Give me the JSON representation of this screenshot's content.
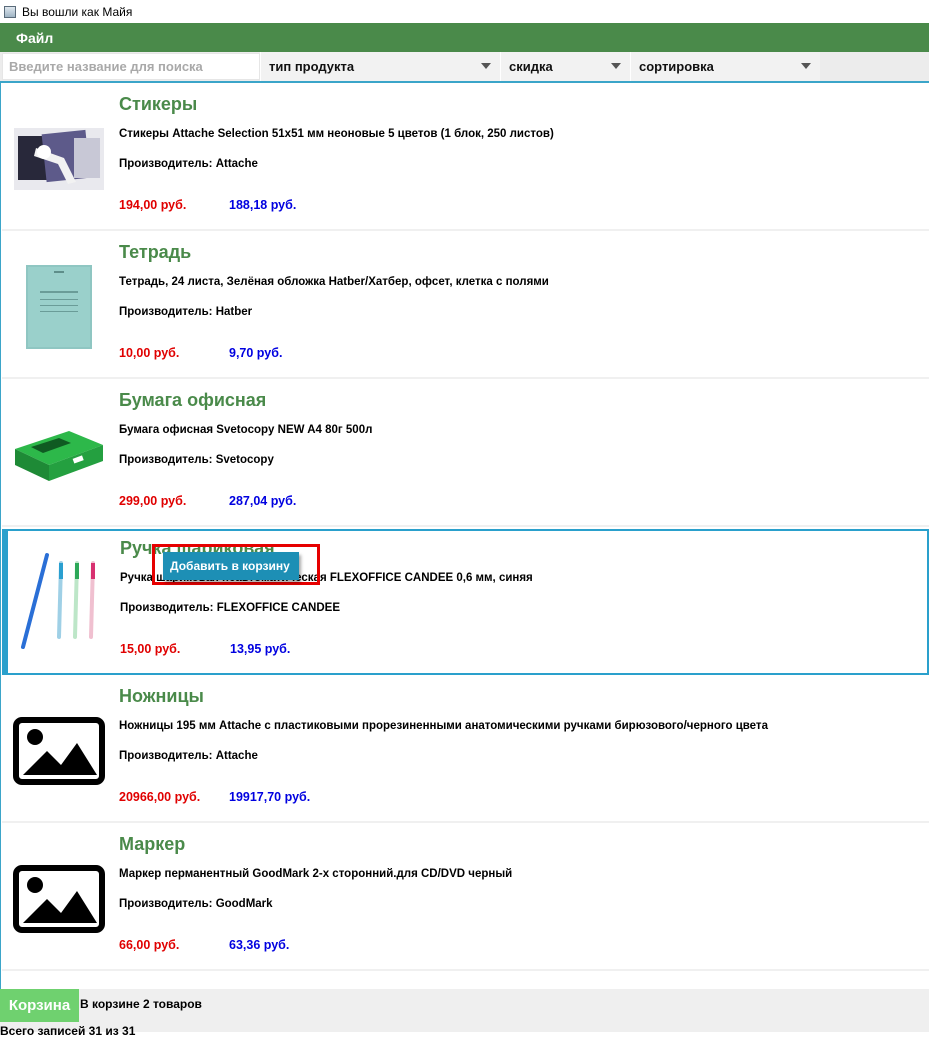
{
  "window": {
    "title": "Вы вошли как Майя"
  },
  "menu": {
    "file": "Файл"
  },
  "filters": {
    "search_placeholder": "Введите название для поиска",
    "search_value": "",
    "type": "тип продукта",
    "discount": "скидка",
    "sort": "сортировка"
  },
  "products": [
    {
      "title": "Стикеры",
      "description": "Стикеры Attache Selection 51x51 мм неоновые 5 цветов (1 блок, 250 листов)",
      "manufacturer": "Производитель: Attache",
      "price": "194,00 руб.",
      "discount_price": "188,18 руб.",
      "image": "photo-sticky-notes"
    },
    {
      "title": "Тетрадь",
      "description": "Тетрадь, 24 листа, Зелёная обложка Hatber/Хатбер, офсет, клетка с полями",
      "manufacturer": "Производитель: Hatber",
      "price": "10,00 руб.",
      "discount_price": "9,70 руб.",
      "image": "photo-notebook"
    },
    {
      "title": "Бумага офисная",
      "description": "Бумага офисная Svetocopy NEW A4 80г 500л",
      "manufacturer": "Производитель: Svetocopy",
      "price": "299,00 руб.",
      "discount_price": "287,04 руб.",
      "image": "photo-paper-pack"
    },
    {
      "title": "Ручка шариковая",
      "description": "Ручка шариковая неавтоматическая FLEXOFFICE CANDEE 0,6 мм, синяя",
      "manufacturer": "Производитель: FLEXOFFICE CANDEE",
      "price": "15,00 руб.",
      "discount_price": "13,95 руб.",
      "image": "photo-pens"
    },
    {
      "title": "Ножницы",
      "description": "Ножницы 195 мм Attache с пластиковыми прорезиненными анатомическими ручками бирюзового/черного цвета",
      "manufacturer": "Производитель: Attache",
      "price": "20966,00 руб.",
      "discount_price": "19917,70 руб.",
      "image": "image-placeholder-icon"
    },
    {
      "title": "Маркер",
      "description": "Маркер перманентный GoodMark 2-х сторонний.для CD/DVD черный",
      "manufacturer": "Производитель: GoodMark",
      "price": "66,00 руб.",
      "discount_price": "63,36 руб.",
      "image": "image-placeholder-icon"
    }
  ],
  "context_menu": {
    "add_to_cart": "Добавить в корзину"
  },
  "footer": {
    "cart_button": "Корзина",
    "cart_status": "В корзине 2 товаров",
    "records": "Всего записей 31 из 31"
  },
  "colors": {
    "accent_green": "#4a8a4a",
    "selection_blue": "#2aa0cc",
    "price_red": "#e00000",
    "discount_blue": "#0000e0",
    "highlight_red": "#e60000",
    "cart_green": "#6fd16f"
  }
}
